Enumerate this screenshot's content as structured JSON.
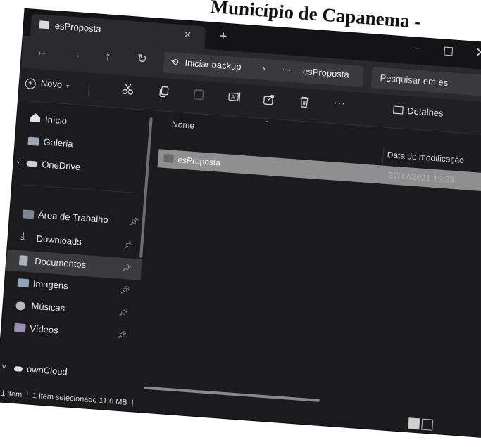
{
  "document_heading": "Município de Capanema -",
  "window": {
    "tab_title": "esProposta",
    "tab_close": "×",
    "new_tab": "+",
    "controls": {
      "minimize": "–",
      "close": "✕"
    }
  },
  "navigation": {
    "back": "←",
    "forward": "→",
    "up": "↑",
    "refresh": "↻"
  },
  "address_bar": {
    "backup_label": "Iniciar backup",
    "separator": "›",
    "more": "···",
    "current": "esProposta"
  },
  "search": {
    "placeholder": "Pesquisar em es"
  },
  "command_bar": {
    "new_label": "Novo",
    "more": "···",
    "details_label": "Detalhes",
    "icons": [
      "cut-icon",
      "copy-icon",
      "paste-icon",
      "rename-icon",
      "share-icon",
      "delete-icon",
      "more-icon"
    ]
  },
  "sidebar": {
    "items": [
      {
        "label": "Início",
        "pinned": false
      },
      {
        "label": "Galeria",
        "pinned": false
      },
      {
        "label": "OneDrive",
        "pinned": false
      },
      {
        "label": "Área de Trabalho",
        "pinned": true
      },
      {
        "label": "Downloads",
        "pinned": true
      },
      {
        "label": "Documentos",
        "pinned": true,
        "selected": true
      },
      {
        "label": "Imagens",
        "pinned": true
      },
      {
        "label": "Músicas",
        "pinned": true
      },
      {
        "label": "Vídeos",
        "pinned": true
      },
      {
        "label": "ownCloud",
        "pinned": false
      }
    ]
  },
  "file_list": {
    "columns": {
      "name": "Nome",
      "modified": "Data de modificação"
    },
    "rows": [
      {
        "name": "esProposta",
        "modified": "27/12/2021 15:33"
      }
    ]
  },
  "status_bar": {
    "count": "1 item",
    "selection": "1 item selecionado",
    "size": "11,0 MB"
  },
  "colors": {
    "window_bg": "#1b1b1d",
    "selected_row": "#8f8f8f",
    "selected_nav": "#3b3b3d"
  }
}
